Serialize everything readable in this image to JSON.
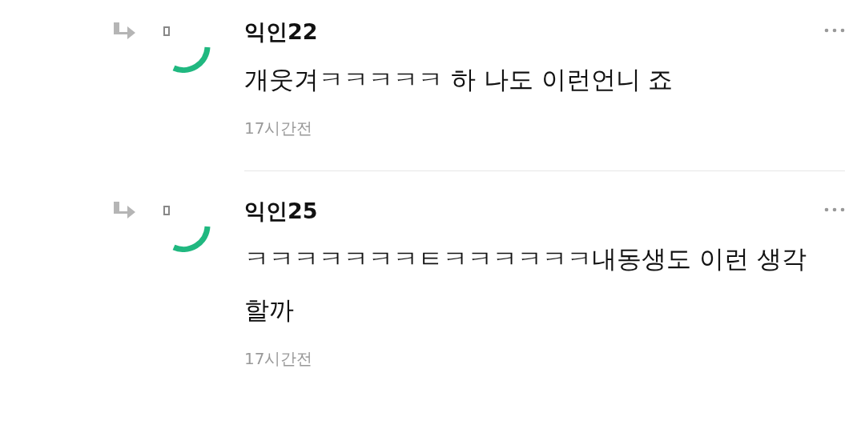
{
  "comments": [
    {
      "author": "익인22",
      "body": "개웃겨ㅋㅋㅋㅋㅋ 하 나도 이런언니 죠",
      "time": "17시간전"
    },
    {
      "author": "익인25",
      "body": "ㅋㅋㅋㅋㅋㅋㅋㅌㅋㅋㅋㅋㅋㅋ내동생도 이런 생각할까",
      "time": "17시간전"
    }
  ]
}
